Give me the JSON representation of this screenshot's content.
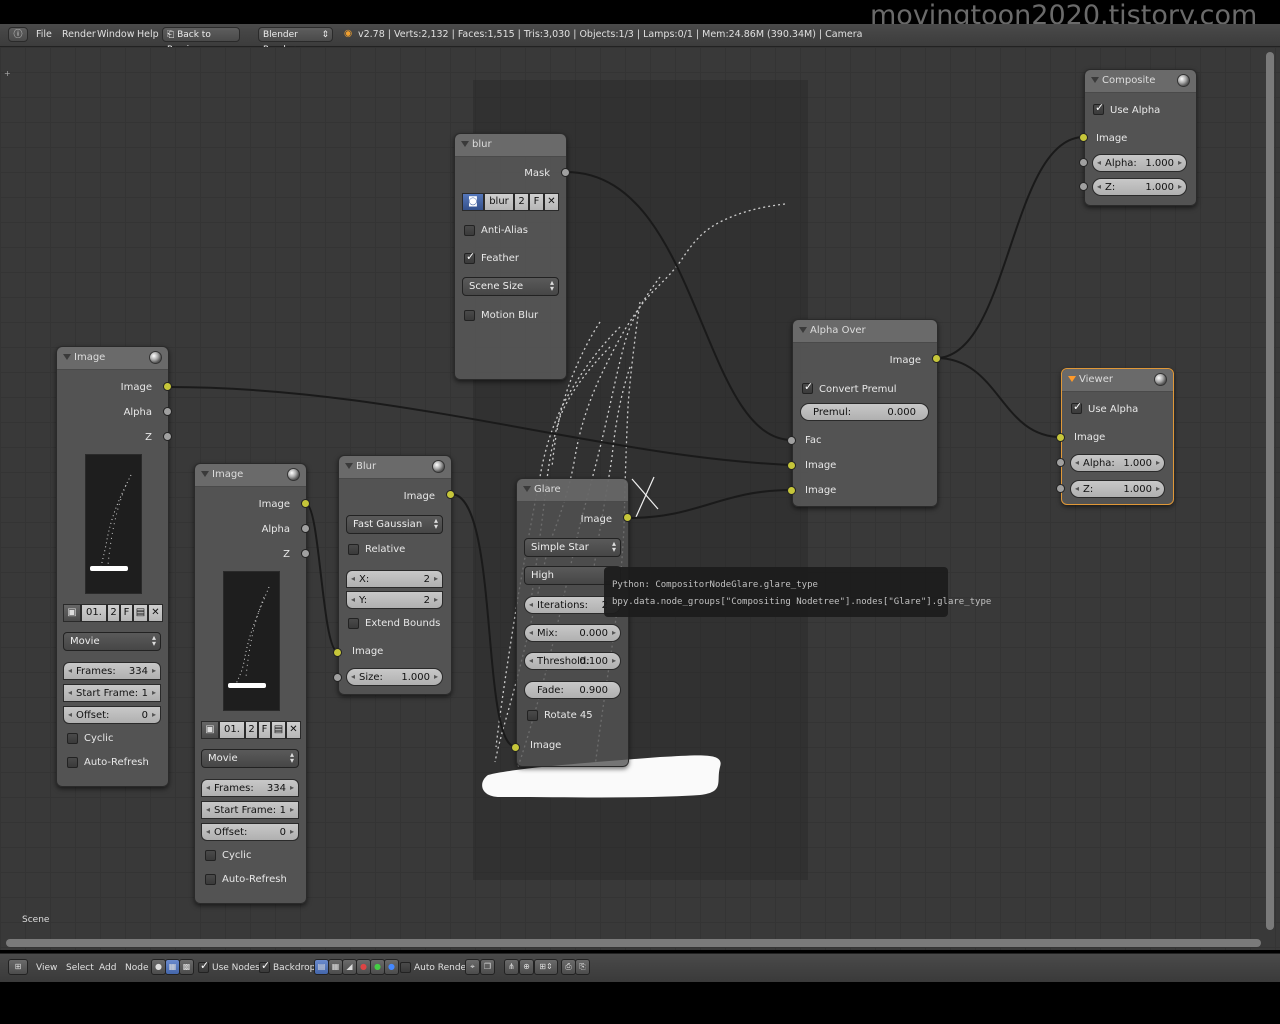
{
  "watermark": "movingtoon2020.tistory.com",
  "header": {
    "menus": [
      "File",
      "Render",
      "Window",
      "Help"
    ],
    "back_button": "Back to Previous",
    "engine": "Blender Render",
    "stats": "v2.78 | Verts:2,132 | Faces:1,515 | Tris:3,030 | Objects:1/3 | Lamps:0/1 | Mem:24.86M (390.34M) | Camera"
  },
  "nodes": {
    "image1": {
      "title": "Image",
      "outputs": [
        "Image",
        "Alpha",
        "Z"
      ],
      "file": {
        "name": "01.",
        "users": "2",
        "fake": "F"
      },
      "source": "Movie",
      "frames_label": "Frames:",
      "frames": "334",
      "start_label": "Start Frame:",
      "start": "1",
      "offset_label": "Offset:",
      "offset": "0",
      "cyclic": "Cyclic",
      "auto_refresh": "Auto-Refresh"
    },
    "image2": {
      "title": "Image",
      "outputs": [
        "Image",
        "Alpha",
        "Z"
      ],
      "file": {
        "name": "01.",
        "users": "2",
        "fake": "F"
      },
      "source": "Movie",
      "frames_label": "Frames:",
      "frames": "334",
      "start_label": "Start Frame:",
      "start": "1",
      "offset_label": "Offset:",
      "offset": "0",
      "cyclic": "Cyclic",
      "auto_refresh": "Auto-Refresh"
    },
    "blur": {
      "title": "Blur",
      "output": "Image",
      "filter": "Fast Gaussian",
      "relative": "Relative",
      "x_label": "X:",
      "x": "2",
      "y_label": "Y:",
      "y": "2",
      "extend": "Extend Bounds",
      "input": "Image",
      "size_label": "Size:",
      "size": "1.000"
    },
    "mask": {
      "title": "blur",
      "output": "Mask",
      "mask_name": "blur",
      "users": "2",
      "fake": "F",
      "anti_alias": "Anti-Alias",
      "feather": "Feather",
      "size_mode": "Scene Size",
      "motion_blur": "Motion Blur"
    },
    "glare": {
      "title": "Glare",
      "output": "Image",
      "type": "Simple Star",
      "quality": "High",
      "iterations_label": "Iterations:",
      "iterations": "2",
      "mix_label": "Mix:",
      "mix": "0.000",
      "threshold_label": "Threshold:",
      "threshold": "0.100",
      "fade_label": "Fade:",
      "fade": "0.900",
      "rotate": "Rotate 45",
      "input": "Image"
    },
    "alpha_over": {
      "title": "Alpha Over",
      "output": "Image",
      "convert": "Convert Premul",
      "premul_label": "Premul:",
      "premul": "0.000",
      "inputs": [
        "Fac",
        "Image",
        "Image"
      ]
    },
    "composite": {
      "title": "Composite",
      "use_alpha": "Use Alpha",
      "input": "Image",
      "alpha_label": "Alpha:",
      "alpha": "1.000",
      "z_label": "Z:",
      "z": "1.000"
    },
    "viewer": {
      "title": "Viewer",
      "use_alpha": "Use Alpha",
      "input": "Image",
      "alpha_label": "Alpha:",
      "alpha": "1.000",
      "z_label": "Z:",
      "z": "1.000"
    }
  },
  "tooltip": {
    "line1": "Python: CompositorNodeGlare.glare_type",
    "line2": "bpy.data.node_groups[\"Compositing Nodetree\"].nodes[\"Glare\"].glare_type"
  },
  "scene_label": "Scene",
  "footer": {
    "menus": [
      "View",
      "Select",
      "Add",
      "Node"
    ],
    "use_nodes": "Use Nodes",
    "backdrop": "Backdrop",
    "auto_render": "Auto Render"
  },
  "colors": {
    "socket_image": "#c6c63a",
    "socket_value": "#a0a0a0",
    "active_node_border": "#e09838",
    "canvas": "#393939"
  }
}
